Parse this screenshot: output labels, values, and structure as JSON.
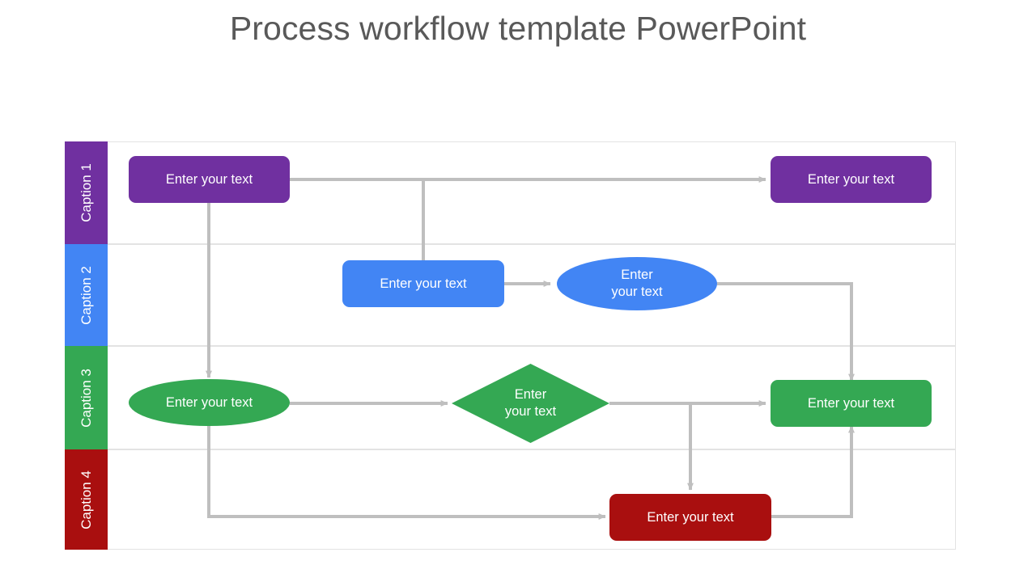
{
  "title": "Process workflow template PowerPoint",
  "colors": {
    "purple": "#7030a0",
    "blue": "#4285f4",
    "green": "#34a853",
    "red": "#a90f0f",
    "connector": "#bfbfbf",
    "lane_border": "#e3e3e3",
    "title_text": "#595959",
    "node_text": "#ffffff"
  },
  "lanes": [
    {
      "id": "lane-1",
      "label": "Caption 1",
      "color": "#7030a0"
    },
    {
      "id": "lane-2",
      "label": "Caption 2",
      "color": "#4285f4"
    },
    {
      "id": "lane-3",
      "label": "Caption 3",
      "color": "#34a853"
    },
    {
      "id": "lane-4",
      "label": "Caption 4",
      "color": "#a90f0f"
    }
  ],
  "nodes": [
    {
      "id": "n1",
      "lane": 1,
      "shape": "rounded-rectangle",
      "color": "#7030a0",
      "text": "Enter your text"
    },
    {
      "id": "n2",
      "lane": 1,
      "shape": "rounded-rectangle",
      "color": "#7030a0",
      "text": "Enter your text"
    },
    {
      "id": "n3",
      "lane": 2,
      "shape": "rounded-rectangle",
      "color": "#4285f4",
      "text": "Enter your text"
    },
    {
      "id": "n4",
      "lane": 2,
      "shape": "ellipse",
      "color": "#4285f4",
      "text_line1": "Enter",
      "text_line2": "your text"
    },
    {
      "id": "n5",
      "lane": 3,
      "shape": "ellipse",
      "color": "#34a853",
      "text": "Enter your text"
    },
    {
      "id": "n6",
      "lane": 3,
      "shape": "diamond",
      "color": "#34a853",
      "text_line1": "Enter",
      "text_line2": "your text"
    },
    {
      "id": "n7",
      "lane": 3,
      "shape": "rounded-rectangle",
      "color": "#34a853",
      "text": "Enter your text"
    },
    {
      "id": "n8",
      "lane": 4,
      "shape": "rounded-rectangle",
      "color": "#a90f0f",
      "text": "Enter your text"
    }
  ]
}
